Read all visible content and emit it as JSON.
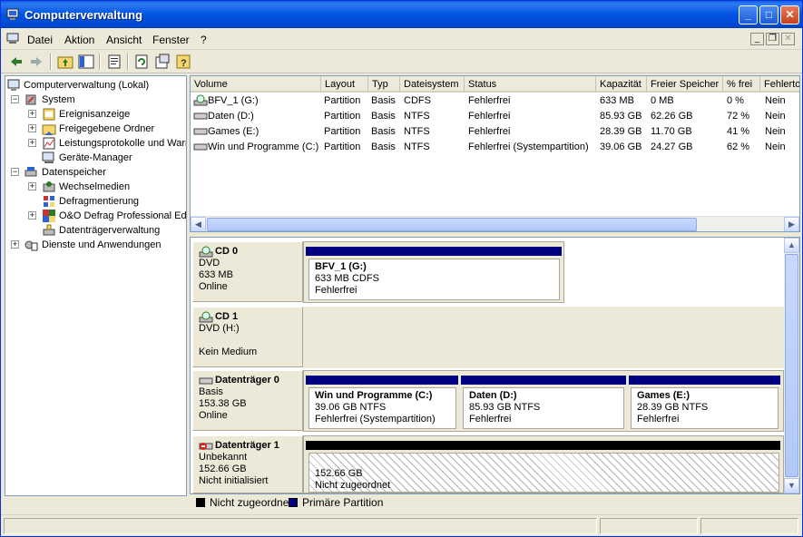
{
  "window": {
    "title": "Computerverwaltung"
  },
  "menu": [
    {
      "label": "Datei"
    },
    {
      "label": "Aktion"
    },
    {
      "label": "Ansicht"
    },
    {
      "label": "Fenster"
    },
    {
      "label": "?"
    }
  ],
  "tree": {
    "root": "Computerverwaltung (Lokal)",
    "system": "System",
    "ereignisanzeige": "Ereignisanzeige",
    "freigegebene_ordner": "Freigegebene Ordner",
    "leistungsprotokolle": "Leistungsprotokolle und Warn",
    "geraete_manager": "Geräte-Manager",
    "datenspeicher": "Datenspeicher",
    "wechselmedien": "Wechselmedien",
    "defragmentierung": "Defragmentierung",
    "oo_defrag": "O&O Defrag Professional Edi",
    "datentraegerverwaltung": "Datenträgerverwaltung",
    "dienste": "Dienste und Anwendungen"
  },
  "volumes": {
    "headers": [
      "Volume",
      "Layout",
      "Typ",
      "Dateisystem",
      "Status",
      "Kapazität",
      "Freier Speicher",
      "% frei",
      "Fehlertoleranz"
    ],
    "rows": [
      [
        "BFV_1 (G:)",
        "Partition",
        "Basis",
        "CDFS",
        "Fehlerfrei",
        "633 MB",
        "0 MB",
        "0 %",
        "Nein"
      ],
      [
        "Daten (D:)",
        "Partition",
        "Basis",
        "NTFS",
        "Fehlerfrei",
        "85.93 GB",
        "62.26 GB",
        "72 %",
        "Nein"
      ],
      [
        "Games (E:)",
        "Partition",
        "Basis",
        "NTFS",
        "Fehlerfrei",
        "28.39 GB",
        "11.70 GB",
        "41 %",
        "Nein"
      ],
      [
        "Win und Programme (C:)",
        "Partition",
        "Basis",
        "NTFS",
        "Fehlerfrei (Systempartition)",
        "39.06 GB",
        "24.27 GB",
        "62 %",
        "Nein"
      ]
    ]
  },
  "disks": {
    "cd0": {
      "name": "CD 0",
      "line1": "DVD",
      "line2": "633 MB",
      "line3": "Online",
      "part": {
        "name": "BFV_1  (G:)",
        "size": "633 MB CDFS",
        "status": "Fehlerfrei"
      }
    },
    "cd1": {
      "name": "CD 1",
      "line1": "DVD (H:)",
      "line2": "",
      "line3": "Kein Medium"
    },
    "disk0": {
      "name": "Datenträger 0",
      "line1": "Basis",
      "line2": "153.38 GB",
      "line3": "Online",
      "parts": [
        {
          "name": "Win und Programme  (C:)",
          "size": "39.06 GB NTFS",
          "status": "Fehlerfrei (Systempartition)"
        },
        {
          "name": "Daten  (D:)",
          "size": "85.93 GB NTFS",
          "status": "Fehlerfrei"
        },
        {
          "name": "Games  (E:)",
          "size": "28.39 GB NTFS",
          "status": "Fehlerfrei"
        }
      ]
    },
    "disk1": {
      "name": "Datenträger 1",
      "line1": "Unbekannt",
      "line2": "152.66 GB",
      "line3": "Nicht initialisiert",
      "part": {
        "size": "152.66 GB",
        "status": "Nicht zugeordnet"
      }
    }
  },
  "legend": {
    "unallocated": "Nicht zugeordnet",
    "primary": "Primäre Partition"
  },
  "colors": {
    "primary": "#000080",
    "unallocated": "#000000",
    "title_bar": "#0054e3"
  }
}
